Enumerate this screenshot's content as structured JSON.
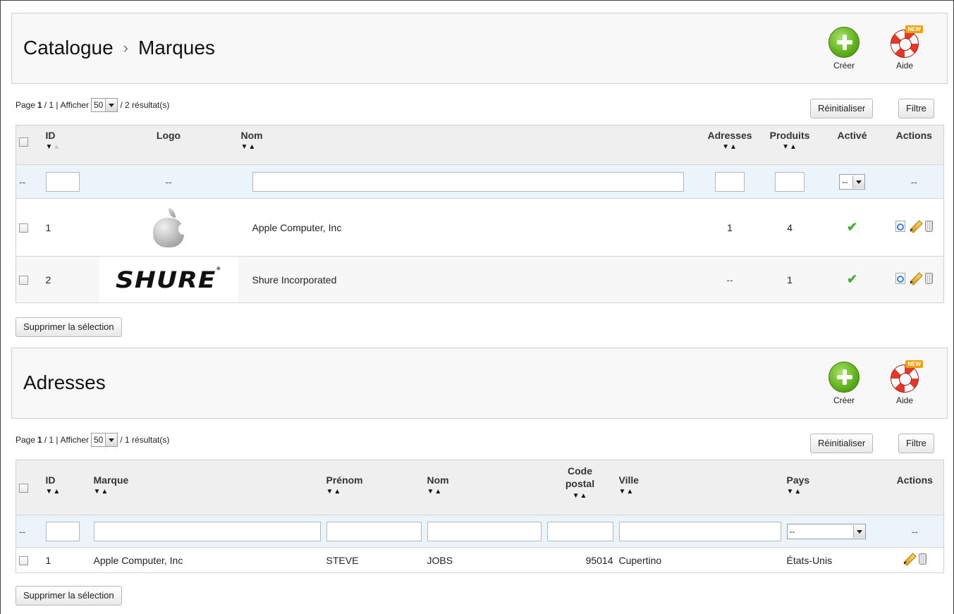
{
  "brands": {
    "breadcrumb": {
      "section": "Catalogue",
      "separator": "›",
      "current": "Marques"
    },
    "create_label": "Créer",
    "help_label": "Aide",
    "help_badge": "NEW",
    "pager": {
      "page_prefix": "Page",
      "page": "1",
      "page_total": "/ 1 |",
      "show_label": "Afficher",
      "per_page": "50",
      "results": "/ 2 résultat(s)"
    },
    "reset_label": "Réinitialiser",
    "filter_label": "Filtre",
    "columns": [
      "ID",
      "Logo",
      "Nom",
      "Adresses",
      "Produits",
      "Activé",
      "Actions"
    ],
    "filter_row": {
      "dash": "--",
      "logo": "--",
      "active": "--",
      "actions": "--"
    },
    "rows": [
      {
        "id": "1",
        "logo": "apple-logo",
        "name": "Apple Computer, Inc",
        "addresses": "1",
        "products": "4",
        "active": "✔"
      },
      {
        "id": "2",
        "logo": "SHURE",
        "logo_mark": "®",
        "name": "Shure Incorporated",
        "addresses": "--",
        "products": "1",
        "active": "✔"
      }
    ],
    "delete_selection": "Supprimer la sélection"
  },
  "addresses": {
    "title": "Adresses",
    "create_label": "Créer",
    "help_label": "Aide",
    "help_badge": "NEW",
    "pager": {
      "page_prefix": "Page",
      "page": "1",
      "page_total": "/ 1 |",
      "show_label": "Afficher",
      "per_page": "50",
      "results": "/ 1 résultat(s)"
    },
    "reset_label": "Réinitialiser",
    "filter_label": "Filtre",
    "columns": [
      "ID",
      "Marque",
      "Prénom",
      "Nom",
      "Code postal",
      "Ville",
      "Pays",
      "Actions"
    ],
    "filter_row": {
      "dash": "--",
      "country": "--",
      "actions": "--"
    },
    "rows": [
      {
        "id": "1",
        "brand": "Apple Computer, Inc",
        "firstname": "STEVE",
        "lastname": "JOBS",
        "postcode": "95014",
        "city": "Cupertino",
        "country": "États-Unis"
      }
    ],
    "delete_selection": "Supprimer la sélection"
  },
  "sort_glyphs": {
    "down": "▼",
    "up": "▲"
  },
  "colors": {
    "accent_green": "#5fae1a",
    "check_green": "#4caa3a",
    "filter_row_bg": "#ebf3fb",
    "header_bg": "#efefef"
  }
}
